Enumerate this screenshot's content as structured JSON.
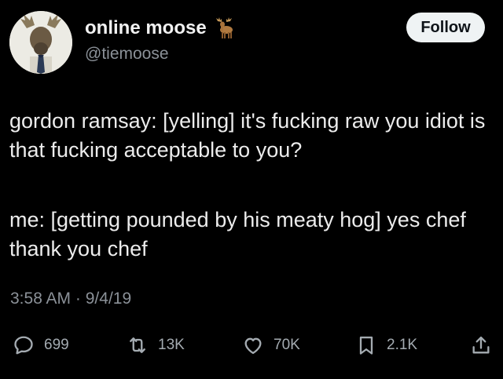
{
  "tweet": {
    "author": {
      "display_name": "online moose",
      "handle": "@tiemoose",
      "badge_icon": "moose-emoji-icon"
    },
    "follow_label": "Follow",
    "paragraphs": [
      "gordon ramsay: [yelling] it's fucking raw you idiot is that fucking acceptable to you?",
      "me: [getting pounded by his meaty hog] yes chef thank you chef"
    ],
    "time": "3:58 AM",
    "separator": "·",
    "date": "9/4/19",
    "actions": {
      "replies": "699",
      "retweets": "13K",
      "likes": "70K",
      "bookmarks": "2.1K"
    }
  },
  "colors": {
    "background": "#000000",
    "text": "#e7e9ea",
    "muted": "#8b9198",
    "follow_bg": "#eff3f4"
  }
}
